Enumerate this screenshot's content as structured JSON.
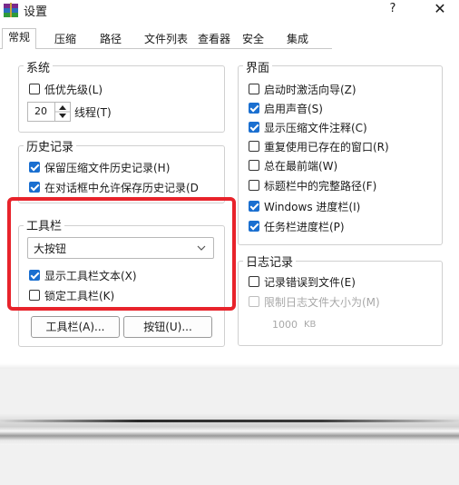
{
  "window": {
    "title": "设置",
    "help_label": "?",
    "close_label": "✕"
  },
  "tabs": [
    "常规",
    "压缩",
    "路径",
    "文件列表",
    "查看器",
    "安全",
    "集成"
  ],
  "active_tab": "常规",
  "system": {
    "title": "系统",
    "low_priority_label": "低优先级(L)",
    "low_priority_checked": false,
    "threads_value": "20",
    "threads_label": "线程(T)"
  },
  "history": {
    "title": "历史记录",
    "keep_history_label": "保留压缩文件历史记录(H)",
    "keep_history_checked": true,
    "dialog_history_label": "在对话框中允许保存历史记录(D",
    "dialog_history_checked": true
  },
  "toolbar": {
    "title": "工具栏",
    "style_value": "大按钮",
    "show_text_label": "显示工具栏文本(X)",
    "show_text_checked": true,
    "lock_label": "锁定工具栏(K)",
    "lock_checked": false,
    "toolbar_button_label": "工具栏(A)...",
    "buttons_button_label": "按钮(U)..."
  },
  "interface": {
    "title": "界面",
    "items": [
      {
        "label": "启动时激活向导(Z)",
        "checked": false
      },
      {
        "label": "启用声音(S)",
        "checked": true
      },
      {
        "label": "显示压缩文件注释(C)",
        "checked": true
      },
      {
        "label": "重复使用已存在的窗口(R)",
        "checked": false
      },
      {
        "label": "总在最前端(W)",
        "checked": false
      },
      {
        "label": "标题栏中的完整路径(F)",
        "checked": false
      },
      {
        "label": "Windows 进度栏(I)",
        "checked": true
      },
      {
        "label": "任务栏进度栏(P)",
        "checked": true
      }
    ]
  },
  "log": {
    "title": "日志记录",
    "log_errors_label": "记录错误到文件(E)",
    "log_errors_checked": false,
    "limit_size_label": "限制日志文件大小为(M)",
    "limit_size_checked": false,
    "size_value": "1000",
    "size_unit": "KB"
  },
  "colors": {
    "accent": "#1a6fd0",
    "highlight": "#e8232b"
  }
}
